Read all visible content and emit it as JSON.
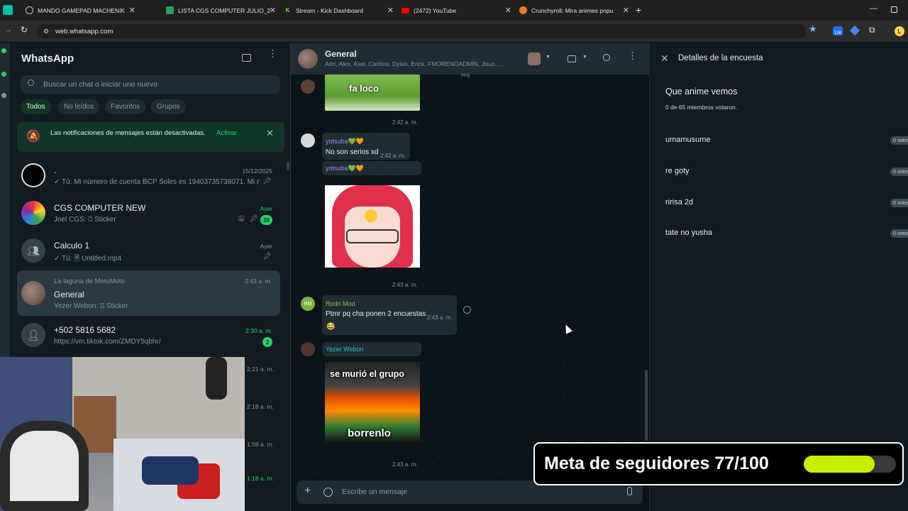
{
  "browser": {
    "tabs": [
      {
        "title": "MANDO GAMEPAD MACHENIK",
        "icon": "globe-icon"
      },
      {
        "title": "LISTA CGS COMPUTER JULIO_2",
        "icon": "sheets-icon"
      },
      {
        "title": "Stream - Kick Dashboard",
        "icon": "kick-icon"
      },
      {
        "title": "(2472) YouTube",
        "icon": "youtube-icon"
      },
      {
        "title": "Crunchyroll: Mira animes popu",
        "icon": "crunchyroll-icon"
      }
    ],
    "url": "web.whatsapp.com",
    "profile_initial": "L"
  },
  "sidebar": {
    "app_title": "WhatsApp",
    "search_placeholder": "Buscar un chat o iniciar uno nuevo",
    "filters": [
      "Todos",
      "No leídos",
      "Favoritos",
      "Grupos"
    ],
    "notice": {
      "text": "Las notificaciones de mensajes están desactivadas.",
      "action": "Activar"
    },
    "chats": [
      {
        "name": ".",
        "preview": "✓ Tú: Mi número de cuenta BCP Soles es 19403735738071. Mi n...",
        "time": "15/12/2025"
      },
      {
        "name": "CGS COMPUTER NEW",
        "preview": "Joel CGS: ⌼ Sticker",
        "time": "Ayer",
        "unread": "20"
      },
      {
        "name": "Calculo 1",
        "preview": "✓ Tú: 🗎 Untitled.mp4",
        "time": "Ayer"
      },
      {
        "group": "La laguna de MotoMoto",
        "name": "General",
        "preview": "Yezer Webon: ⌼ Sticker",
        "time": "2:43 a. m."
      },
      {
        "name": "+502 5816 5682",
        "preview": "https://vm.tiktok.com/ZMDY5qbhr/",
        "time": "2:30 a. m.",
        "unread": "2"
      }
    ],
    "hidden_times": [
      "2:21 a. m.",
      "2:18 a. m.",
      "1:59 a. m.",
      "1:18 a. m."
    ]
  },
  "chat": {
    "title": "General",
    "members": "Adri, Alex, Axel, Carlitos, Dylan, Erick, FMORENOADMIN, Jisus, ...",
    "day_label": "Hoy",
    "messages": [
      {
        "sticker": "fa loco",
        "time": "2:42 a. m."
      },
      {
        "sender": "yotsuba💚🧡",
        "text": "No son serios xd",
        "time": "2:42 a. m."
      },
      {
        "sender": "yotsuba💚🧡",
        "sticker": "anime-girl",
        "time": "2:43 a. m."
      },
      {
        "sender": "Rodri Mod",
        "initials": "RM",
        "text": "Ptmr pq cha ponen 2 encuestas",
        "emoji": "😂",
        "time": "2:43 a. m."
      },
      {
        "sender": "Yezer Webon",
        "sticker_top": "se murió el grupo",
        "sticker_bottom": "borrenlo",
        "time": "2:43 a. m."
      }
    ],
    "composer_placeholder": "Escribe un mensaje"
  },
  "poll": {
    "header": "Detalles de la encuesta",
    "question": "Que anime vemos",
    "summary": "0 de 65 miembros votaron.",
    "options": [
      {
        "label": "umamusume",
        "votes": "0 votos"
      },
      {
        "label": "re goty",
        "votes": "0 votos"
      },
      {
        "label": "ririsa 2d",
        "votes": "0 votos"
      },
      {
        "label": "tate no yusha",
        "votes": "0 votos"
      }
    ]
  },
  "overlay": {
    "goal_text": "Meta de seguidores 77/100",
    "goal_progress": 0.77,
    "bar_color": "#c6f000"
  },
  "colors": {
    "accent": "#25d366",
    "panel": "#111b21",
    "bubble": "#202c33"
  }
}
